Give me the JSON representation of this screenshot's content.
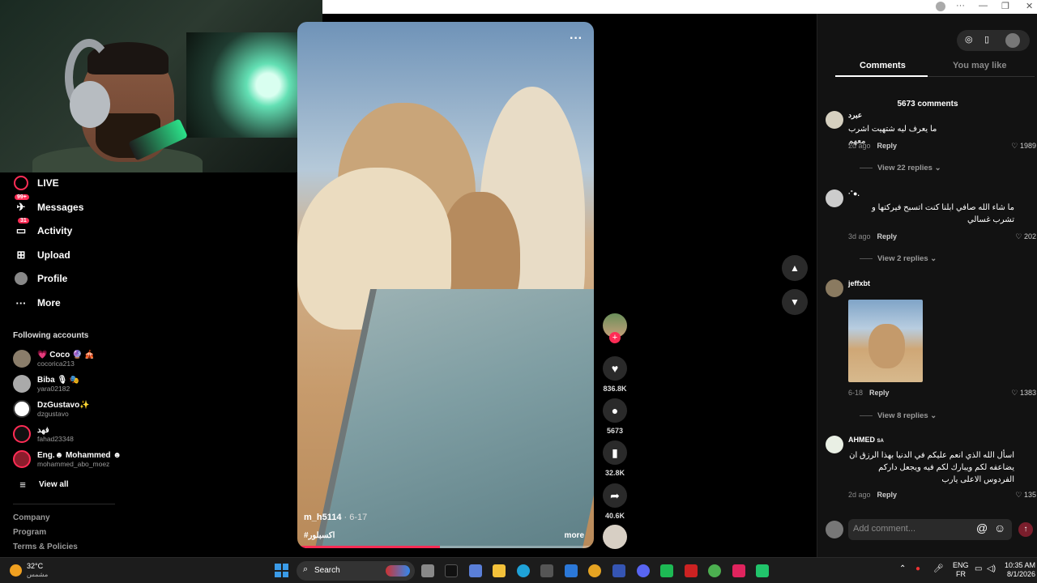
{
  "webcam": {
    "label": "Webcam overlay"
  },
  "browser": {
    "top_icons": [
      "avatar-icon",
      "more-icon",
      "minimize-icon",
      "restore-icon",
      "close-icon"
    ]
  },
  "sidebar": {
    "nav": [
      {
        "label": "LIVE",
        "icon": "live-icon",
        "badge": ""
      },
      {
        "label": "Messages",
        "icon": "messages-icon",
        "badge": "99+"
      },
      {
        "label": "Activity",
        "icon": "activity-icon",
        "badge": "31"
      },
      {
        "label": "Upload",
        "icon": "upload-icon",
        "badge": ""
      },
      {
        "label": "Profile",
        "icon": "profile-icon",
        "badge": ""
      },
      {
        "label": "More",
        "icon": "more-icon",
        "badge": ""
      }
    ],
    "following_title": "Following accounts",
    "following": [
      {
        "name": "💗 Coco 🔮 🎪",
        "handle": "cocorica213"
      },
      {
        "name": "Biba 🎙 🎭",
        "handle": "yara02182"
      },
      {
        "name": "DzGustavo✨",
        "handle": "dzgustavo"
      },
      {
        "name": "فهد",
        "handle": "fahad23348"
      },
      {
        "name": "Eng.☻ Mohammed ☻",
        "handle": "mohammed_abo_moez"
      }
    ],
    "view_all": "View all",
    "footer": [
      "Company",
      "Program",
      "Terms & Policies"
    ]
  },
  "video": {
    "author": "m_h5114",
    "date": "6-17",
    "hashtag": "#اكسبلور",
    "more": "more",
    "menu": "···",
    "progress": 0.48
  },
  "actions": {
    "likes": "836.8K",
    "comments": "5673",
    "saves": "32.8K",
    "shares": "40.6K"
  },
  "panel": {
    "tabs": [
      "Comments",
      "You may like"
    ],
    "count": "5673 comments",
    "comments": [
      {
        "user": "عبرد",
        "text": "ما يعرف ليه شتهيت اشرب معهم",
        "date": "2d ago",
        "likes": "1989",
        "replies": "View 22 replies"
      },
      {
        "user": "·˚●.",
        "text": "ما شاء الله صافي ابلنا كنت اتسبح فيركتها و تشرب غسالي",
        "date": "3d ago",
        "likes": "202",
        "replies": "View 2 replies"
      },
      {
        "user": "jeffxbt",
        "text": "",
        "date": "6-18",
        "likes": "1383",
        "replies": "View 8 replies"
      },
      {
        "user": "AHMED",
        "flag": "SA",
        "text": "اسأل الله الذي انعم عليكم في الدنيا بهذا الرزق ان يضاعفه لكم ويبارك لكم فيه ويجعل داركم الفردوس الاعلى يارب",
        "date": "2d ago",
        "likes": "135",
        "replies": ""
      }
    ],
    "reply_label": "Reply",
    "add_placeholder": "Add comment..."
  },
  "taskbar": {
    "weather_temp": "32°C",
    "weather_place": "مشمس",
    "search": "Search",
    "lang1": "ENG",
    "lang2": "FR",
    "time": "10:35 AM",
    "date": "8/1/2026"
  }
}
